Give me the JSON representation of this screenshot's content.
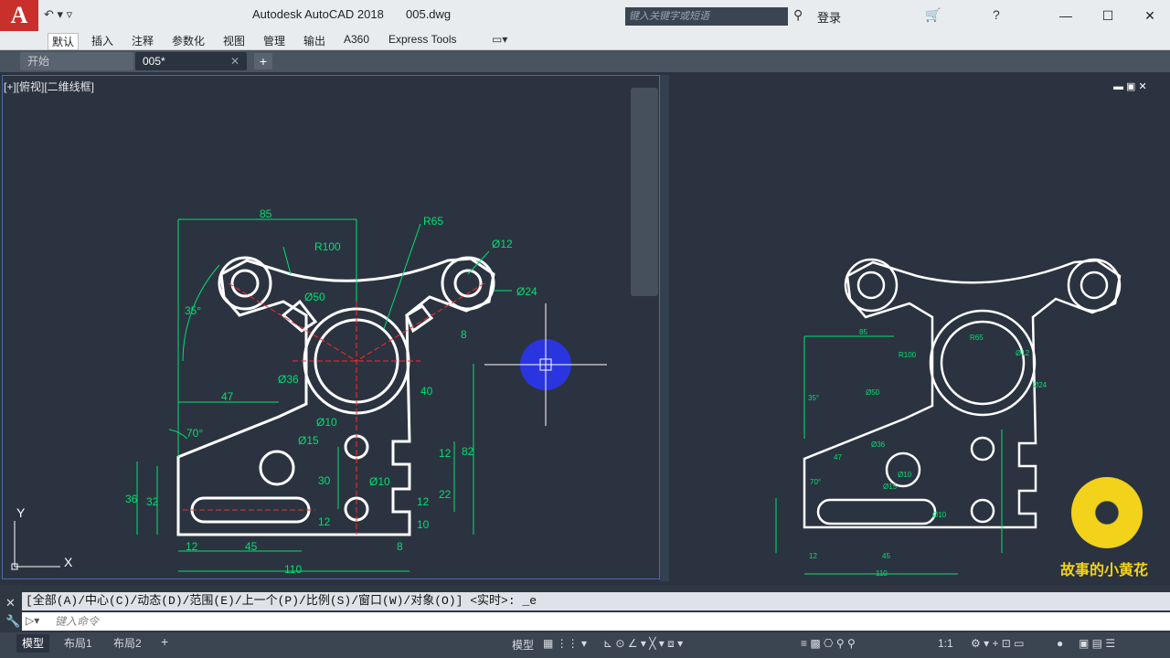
{
  "titlebar": {
    "app": "Autodesk AutoCAD 2018",
    "file": "005.dwg",
    "search_placeholder": "键入关键字或短语",
    "login": "登录",
    "logo_letter": "A"
  },
  "ribbon_tabs": [
    "默认",
    "插入",
    "注释",
    "参数化",
    "视图",
    "管理",
    "输出",
    "A360",
    "Express Tools"
  ],
  "file_tabs": [
    "开始",
    "005*"
  ],
  "viewport_label": "[+][俯视][二维线框]",
  "drawing": {
    "dims": {
      "d85": "85",
      "r100": "R100",
      "r65": "R65",
      "d12": "Ø12",
      "d24": "Ø24",
      "d50": "Ø50",
      "a35": "35°",
      "d8a": "8",
      "d36c": "Ø36",
      "d47": "47",
      "d40": "40",
      "a70": "70°",
      "d10a": "Ø10",
      "d15": "Ø15",
      "d82": "82",
      "d12b": "12",
      "d30": "30",
      "d22": "22",
      "d10b": "Ø10",
      "d36": "36",
      "d32": "32",
      "d12c": "12",
      "d12d": "12",
      "d10c": "10",
      "d12e": "12",
      "d45": "45",
      "d8b": "8",
      "d110": "110"
    }
  },
  "ucs": {
    "y": "Y",
    "x": "X"
  },
  "command": {
    "history": "[全部(A)/中心(C)/动态(D)/范围(E)/上一个(P)/比例(S)/窗口(W)/对象(O)] <实时>: _e",
    "placeholder": "键入命令"
  },
  "layout_tabs": [
    "模型",
    "布局1",
    "布局2"
  ],
  "status": {
    "model": "模型",
    "scale": "1:1"
  },
  "watermark": "故事的小黄花",
  "colors": {
    "dim": "#00e070",
    "center": "#ff2a2a",
    "geometry": "#ffffff",
    "cursor_blob": "#2a35e0"
  }
}
